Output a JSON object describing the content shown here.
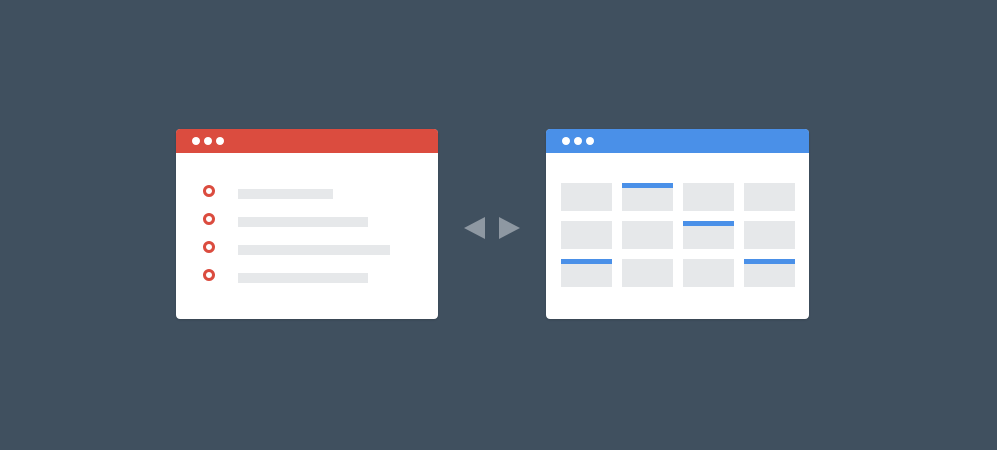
{
  "colors": {
    "background": "#40505f",
    "list_accent": "#db4c3f",
    "grid_accent": "#4a90e8",
    "placeholder": "#e6e8ea",
    "arrow": "#8e98a2"
  },
  "list_window": {
    "titlebar_icon": "three-dots-icon",
    "items": [
      {
        "icon": "radio-circle-icon",
        "fill": 0.6
      },
      {
        "icon": "radio-circle-icon",
        "fill": 0.82
      },
      {
        "icon": "radio-circle-icon",
        "fill": 0.96
      },
      {
        "icon": "radio-circle-icon",
        "fill": 0.82
      }
    ]
  },
  "grid_window": {
    "titlebar_icon": "three-dots-icon",
    "rows": [
      [
        false,
        true,
        false,
        false
      ],
      [
        false,
        false,
        true,
        false
      ],
      [
        true,
        false,
        false,
        true
      ]
    ]
  },
  "switch_icon": "swap-arrows-icon"
}
